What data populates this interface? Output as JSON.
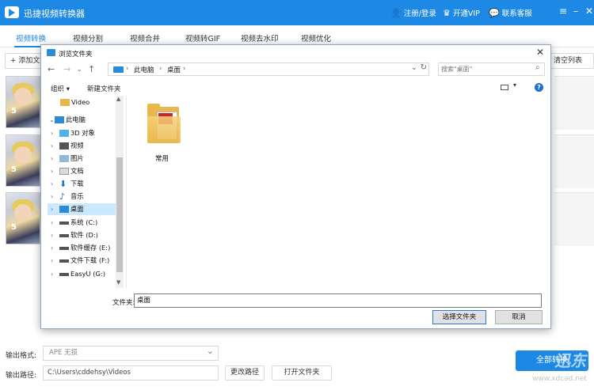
{
  "app": {
    "title": "迅捷视频转换器",
    "register_login": "注册/登录",
    "vip": "开通VIP",
    "support": "联系客服"
  },
  "tabs": [
    "视频转换",
    "视频分割",
    "视频合并",
    "视频转GIF",
    "视频去水印",
    "视频优化"
  ],
  "toolbar": {
    "add_file": "+ 添加文",
    "clear_list": "清空列表"
  },
  "file_rows": [
    {
      "num": "5"
    },
    {
      "num": "5"
    },
    {
      "num": "5"
    }
  ],
  "bottom": {
    "format_label": "输出格式:",
    "format_value": "APE  无损",
    "path_label": "输出路径:",
    "path_value": "C:\\Users\\cddehsy\\Videos",
    "change_path": "更改路径",
    "open_folder": "打开文件夹",
    "convert_all": "全部转换",
    "watermark": "迅东CAD",
    "watermark_url": "www.xdcad.net"
  },
  "dialog": {
    "title": "浏览文件夹",
    "address": [
      "此电脑",
      "桌面"
    ],
    "search_placeholder": "搜索\"桌面\"",
    "organize": "组织 ▾",
    "new_folder": "新建文件夹",
    "tree": [
      {
        "label": "Video",
        "icon": "folder-icon"
      },
      {
        "label": "此电脑",
        "icon": "computer-icon"
      },
      {
        "label": "3D 对象",
        "icon": "cube-icon"
      },
      {
        "label": "视频",
        "icon": "video-icon"
      },
      {
        "label": "图片",
        "icon": "picture-icon"
      },
      {
        "label": "文档",
        "icon": "document-icon"
      },
      {
        "label": "下载",
        "icon": "download-icon"
      },
      {
        "label": "音乐",
        "icon": "music-icon"
      },
      {
        "label": "桌面",
        "icon": "desktop-icon"
      },
      {
        "label": "系统 (C:)",
        "icon": "drive-icon"
      },
      {
        "label": "软件 (D:)",
        "icon": "drive-icon"
      },
      {
        "label": "软件缓存 (E:)",
        "icon": "drive-icon"
      },
      {
        "label": "文件下载 (F:)",
        "icon": "drive-icon"
      },
      {
        "label": "EasyU (G:)",
        "icon": "drive-icon"
      }
    ],
    "folder_name": "常用",
    "folder_field_label": "文件夹:",
    "folder_field_value": "桌面",
    "select_folder": "选择文件夹",
    "cancel": "取消"
  },
  "colors": {
    "accent": "#1e88e5",
    "tree_selected": "#cce8ff"
  }
}
